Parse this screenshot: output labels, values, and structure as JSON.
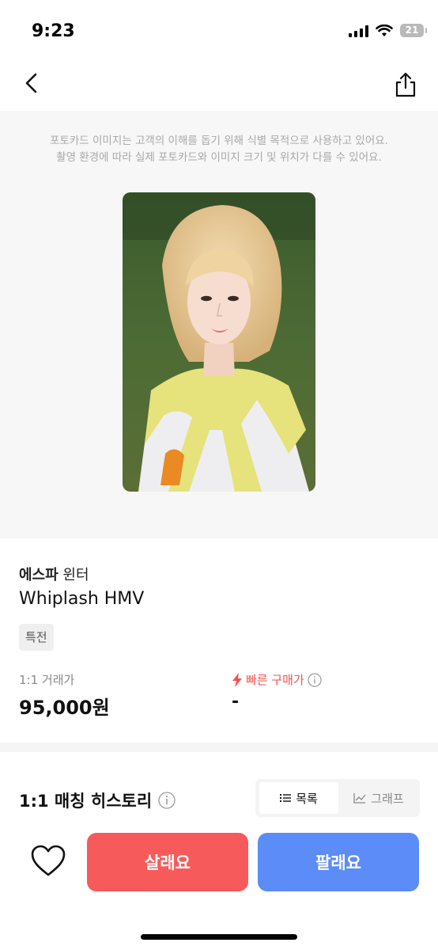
{
  "status_bar": {
    "time": "9:23",
    "battery": "21"
  },
  "notice": {
    "line1": "포토카드 이미지는 고객의 이해를 돕기 위해 식별 목적으로 사용하고 있어요.",
    "line2": "촬영 환경에 따라 실제 포토카드와 이미지 크기 및 위치가 다를 수 있어요."
  },
  "product": {
    "group": "에스파",
    "member": "윈터",
    "title": "Whiplash HMV",
    "badge": "특전"
  },
  "prices": {
    "trade_label": "1:1 거래가",
    "trade_value": "95,000원",
    "fast_label": "빠른 구매가",
    "fast_value": "-"
  },
  "history": {
    "title": "1:1 매칭 히스토리",
    "tab_list": "목록",
    "tab_graph": "그래프"
  },
  "actions": {
    "buy": "살래요",
    "sell": "팔래요"
  },
  "colors": {
    "buy": "#f75a5a",
    "sell": "#5b8cf8",
    "fast_price": "#f0534e"
  }
}
